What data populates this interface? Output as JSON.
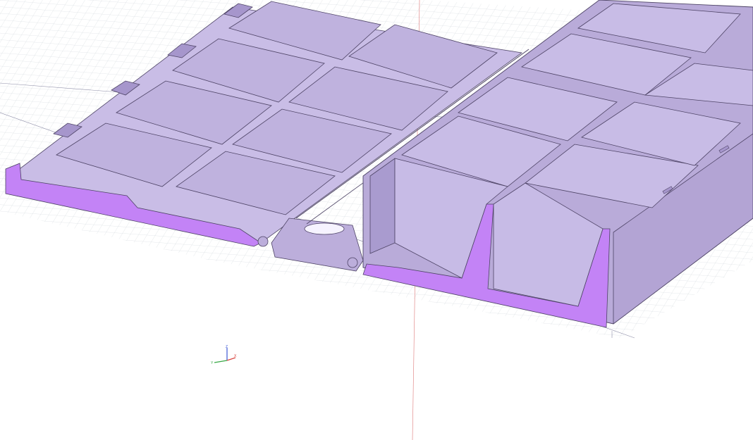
{
  "app": {
    "view": "3D CAD viewport",
    "grid": true,
    "section_view": true
  },
  "model": {
    "description_hidden": "",
    "colors": {
      "body": "#bcaedb",
      "body_light": "#cfc3ea",
      "body_dark": "#a696cc",
      "edge": "#4e4466",
      "section": "#c383f6",
      "grid": "#8b9aa6",
      "axis_red": "#e28b8b",
      "axis_green": "#37a845",
      "axis_blue": "#3b57d6"
    }
  },
  "triad": {
    "x": "X",
    "y": "Y",
    "z": "Z"
  }
}
